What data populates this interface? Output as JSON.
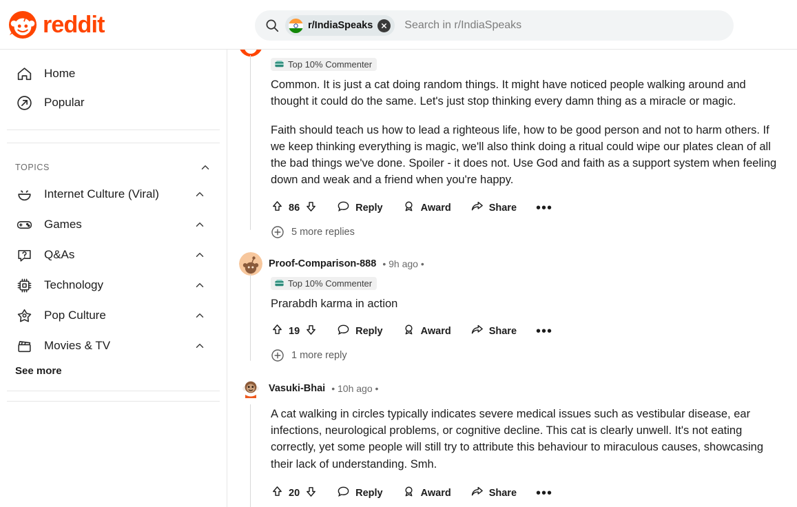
{
  "header": {
    "brand_name": "reddit",
    "brand_color": "#ff4500",
    "logo_icon": "reddit-snoo-logo",
    "search": {
      "icon": "search-icon",
      "chip_label": "r/IndiaSpeaks",
      "chip_icon": "india-flag-icon",
      "chip_clear_icon": "close-icon",
      "placeholder": "Search in r/IndiaSpeaks",
      "value": ""
    }
  },
  "sidebar": {
    "nav": [
      {
        "label": "Home",
        "icon": "home-icon"
      },
      {
        "label": "Popular",
        "icon": "popular-arrow-icon"
      }
    ],
    "topics_section": {
      "title": "TOPICS",
      "chevron_icon": "chevron-up-icon"
    },
    "topics": [
      {
        "label": "Internet Culture (Viral)",
        "icon": "smiley-icon",
        "chevron": "chevron-up-icon"
      },
      {
        "label": "Games",
        "icon": "gamepad-icon",
        "chevron": "chevron-up-icon"
      },
      {
        "label": "Q&As",
        "icon": "question-bubble-icon",
        "chevron": "chevron-up-icon"
      },
      {
        "label": "Technology",
        "icon": "chip-icon",
        "chevron": "chevron-up-icon"
      },
      {
        "label": "Pop Culture",
        "icon": "star-icon",
        "chevron": "chevron-up-icon"
      },
      {
        "label": "Movies & TV",
        "icon": "clapperboard-icon",
        "chevron": "chevron-up-icon"
      }
    ],
    "see_more_label": "See more"
  },
  "actions_labels": {
    "reply": "Reply",
    "award": "Award",
    "share": "Share",
    "overflow": "•••",
    "upvote_icon": "upvote-arrow-icon",
    "downvote_icon": "downvote-arrow-icon",
    "reply_icon": "comment-bubble-icon",
    "award_icon": "award-medal-icon",
    "share_icon": "share-arrow-icon"
  },
  "comments": [
    {
      "id": "c1",
      "username": "",
      "meta": "",
      "badge": "Top 10% Commenter",
      "badge_icon": "top-commenter-badge-icon",
      "avatar_color": "#ff4500",
      "paragraphs": [
        "Common. It is just a cat doing random things. It might have noticed people walking around and thought it could do the same. Let's just stop thinking every damn thing as a miracle or magic.",
        "Faith should teach us how to lead a righteous life, how to be good person and not to harm others. If we keep thinking everything is magic, we'll also think doing a ritual could wipe our plates clean of all the bad things we've done. Spoiler - it does not. Use God and faith as a support system when feeling down and weak and a friend when you're happy."
      ],
      "votes": "86",
      "more_replies": "5 more replies"
    },
    {
      "id": "c2",
      "username": "Proof-Comparison-888",
      "meta": "• 9h ago •",
      "badge": "Top 10% Commenter",
      "badge_icon": "top-commenter-badge-icon",
      "avatar_color": "#f2b08a",
      "paragraphs": [
        "Prarabdh karma in action"
      ],
      "votes": "19",
      "more_replies": "1 more reply"
    },
    {
      "id": "c3",
      "username": "Vasuki-Bhai",
      "meta": "• 10h ago •",
      "badge": "",
      "badge_icon": "",
      "avatar_color": "#ffffff",
      "paragraphs": [
        "A cat walking in circles typically indicates severe medical issues such as vestibular disease, ear infections, neurological problems, or cognitive decline. This cat is clearly unwell. It's not eating correctly, yet some people will still try to attribute this behaviour to miraculous causes, showcasing their lack of understanding. Smh."
      ],
      "votes": "20",
      "more_replies": ""
    }
  ]
}
